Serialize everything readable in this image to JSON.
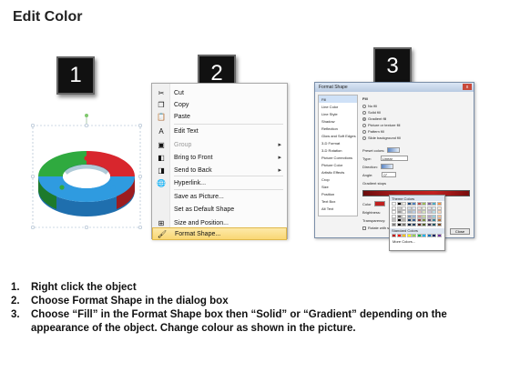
{
  "title": "Edit Color",
  "step_numbers": [
    "1",
    "2",
    "3"
  ],
  "context_menu": {
    "items": [
      {
        "label": "Cut",
        "icon": "scissors-icon",
        "glyph": "✂",
        "disabled": false,
        "submenu": false
      },
      {
        "label": "Copy",
        "icon": "copy-icon",
        "glyph": "❐",
        "disabled": false,
        "submenu": false
      },
      {
        "label": "Paste",
        "icon": "paste-icon",
        "glyph": "📋",
        "disabled": false,
        "submenu": false
      },
      {
        "label": "Edit Text",
        "icon": "edit-text-icon",
        "glyph": "A",
        "disabled": false,
        "submenu": false
      },
      {
        "label": "Group",
        "icon": "group-icon",
        "glyph": "▣",
        "disabled": true,
        "submenu": true
      },
      {
        "label": "Bring to Front",
        "icon": "bring-to-front-icon",
        "glyph": "◧",
        "disabled": false,
        "submenu": true
      },
      {
        "label": "Send to Back",
        "icon": "send-to-back-icon",
        "glyph": "◨",
        "disabled": false,
        "submenu": true
      },
      {
        "label": "Hyperlink...",
        "icon": "hyperlink-icon",
        "glyph": "🌐",
        "disabled": false,
        "submenu": false
      },
      {
        "label": "Save as Picture...",
        "icon": "",
        "glyph": "",
        "disabled": false,
        "submenu": false
      },
      {
        "label": "Set as Default Shape",
        "icon": "",
        "glyph": "",
        "disabled": false,
        "submenu": false
      },
      {
        "label": "Size and Position...",
        "icon": "size-position-icon",
        "glyph": "⊞",
        "disabled": false,
        "submenu": false
      },
      {
        "label": "Format Shape...",
        "icon": "format-shape-icon",
        "glyph": "🖌",
        "disabled": false,
        "submenu": false
      }
    ]
  },
  "format_dialog": {
    "title": "Format Shape",
    "close": "x",
    "categories": [
      "Fill",
      "Line Color",
      "Line Style",
      "Shadow",
      "Reflection",
      "Glow and Soft Edges",
      "3-D Format",
      "3-D Rotation",
      "Picture Corrections",
      "Picture Color",
      "Artistic Effects",
      "Crop",
      "Size",
      "Position",
      "Text Box",
      "Alt Text"
    ],
    "section": "Fill",
    "options": [
      {
        "label": "No fill",
        "selected": false
      },
      {
        "label": "Solid fill",
        "selected": false
      },
      {
        "label": "Gradient fill",
        "selected": true
      },
      {
        "label": "Picture or texture fill",
        "selected": false
      },
      {
        "label": "Pattern fill",
        "selected": false
      },
      {
        "label": "Slide background fill",
        "selected": false
      }
    ],
    "preset_label": "Preset colors:",
    "type_label": "Type:",
    "type_value": "Linear",
    "direction_label": "Direction:",
    "angle_label": "Angle:",
    "angle_value": "0°",
    "stops_label": "Gradient stops",
    "color_label": "Color",
    "position_label": "Position:",
    "position_value": "0%",
    "brightness_label": "Brightness:",
    "transparency_label": "Transparency:",
    "rotate_label": "Rotate with shape",
    "close_button": "Close"
  },
  "palette": {
    "theme_label": "Theme Colors",
    "standard_label": "Standard Colors",
    "more_label": "More Colors...",
    "theme_colors": [
      "#ffffff",
      "#000000",
      "#eeece1",
      "#1f497d",
      "#4f81bd",
      "#c0504d",
      "#9bbb59",
      "#8064a2",
      "#4bacc6",
      "#f79646"
    ],
    "standard_colors": [
      "#c00000",
      "#ff0000",
      "#ffc000",
      "#ffff00",
      "#92d050",
      "#00b050",
      "#00b0f0",
      "#0070c0",
      "#002060",
      "#7030a0"
    ]
  },
  "chart_colors": {
    "green": "#2faa3f",
    "red": "#d8262d",
    "blue": "#2f9be0"
  },
  "steps": [
    {
      "num": "1.",
      "text": "Right click the object"
    },
    {
      "num": "2.",
      "text": "Choose Format Shape in the dialog box"
    },
    {
      "num": "3.",
      "text": "Choose “Fill” in the Format Shape box then “Solid” or “Gradient” depending on the appearance of the object. Change colour as shown in the picture."
    }
  ]
}
